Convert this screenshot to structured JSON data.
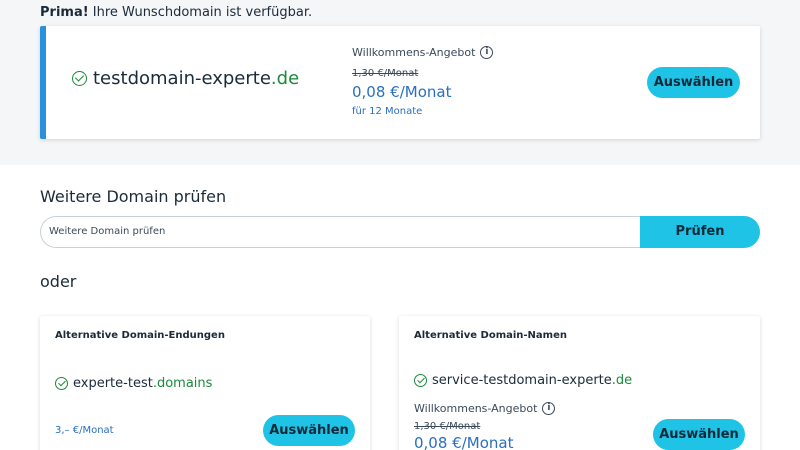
{
  "availability": {
    "prefix": "Prima!",
    "message": "Ihre Wunschdomain ist verfügbar."
  },
  "result": {
    "domain_name": "testdomain-experte",
    "domain_tld": ".de",
    "offer_label": "Willkommens-Angebot",
    "old_price": "1,30 €/Monat",
    "new_price": "0,08 €/Monat",
    "period": "für 12 Monate",
    "select_label": "Auswählen"
  },
  "search": {
    "title": "Weitere Domain prüfen",
    "placeholder": "Weitere Domain prüfen",
    "button_label": "Prüfen"
  },
  "or_label": "oder",
  "alt_endings": {
    "title": "Alternative Domain-Endungen",
    "domain_name": "experte-test",
    "domain_tld": ".domains",
    "price": "3,– €/Monat",
    "select_label": "Auswählen"
  },
  "alt_names": {
    "title": "Alternative Domain-Namen",
    "domain_name": "service-testdomain-experte",
    "domain_tld": ".de",
    "offer_label": "Willkommens-Angebot",
    "old_price": "1,30 €/Monat",
    "new_price": "0,08 €/Monat",
    "select_label": "Auswählen"
  },
  "icons": {
    "check": "check-circle-icon",
    "info": "info-icon"
  },
  "colors": {
    "accent": "#1ec3e6",
    "success": "#1a8a3a",
    "price": "#2a6fc0",
    "card_border": "#2a8fdc"
  }
}
